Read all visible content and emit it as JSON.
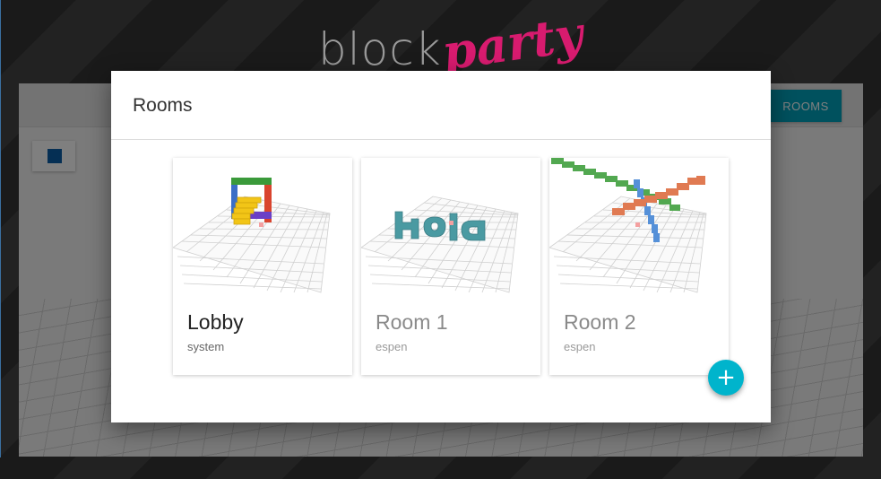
{
  "logo": {
    "word1": "block",
    "word2": "party"
  },
  "app": {
    "rooms_button": "ROOMS",
    "selected_color": "#0b5fa8"
  },
  "dialog": {
    "title": "Rooms",
    "add_button_icon": "+",
    "cards": [
      {
        "name": "Lobby",
        "owner": "system",
        "thumbnail": "lobby-scene"
      },
      {
        "name": "Room 1",
        "owner": "espen",
        "thumbnail": "hola-scene"
      },
      {
        "name": "Room 2",
        "owner": "espen",
        "thumbnail": "cross-scene"
      }
    ]
  },
  "colors": {
    "accent": "#00a3bc",
    "brand_pink": "#d81b6f"
  }
}
